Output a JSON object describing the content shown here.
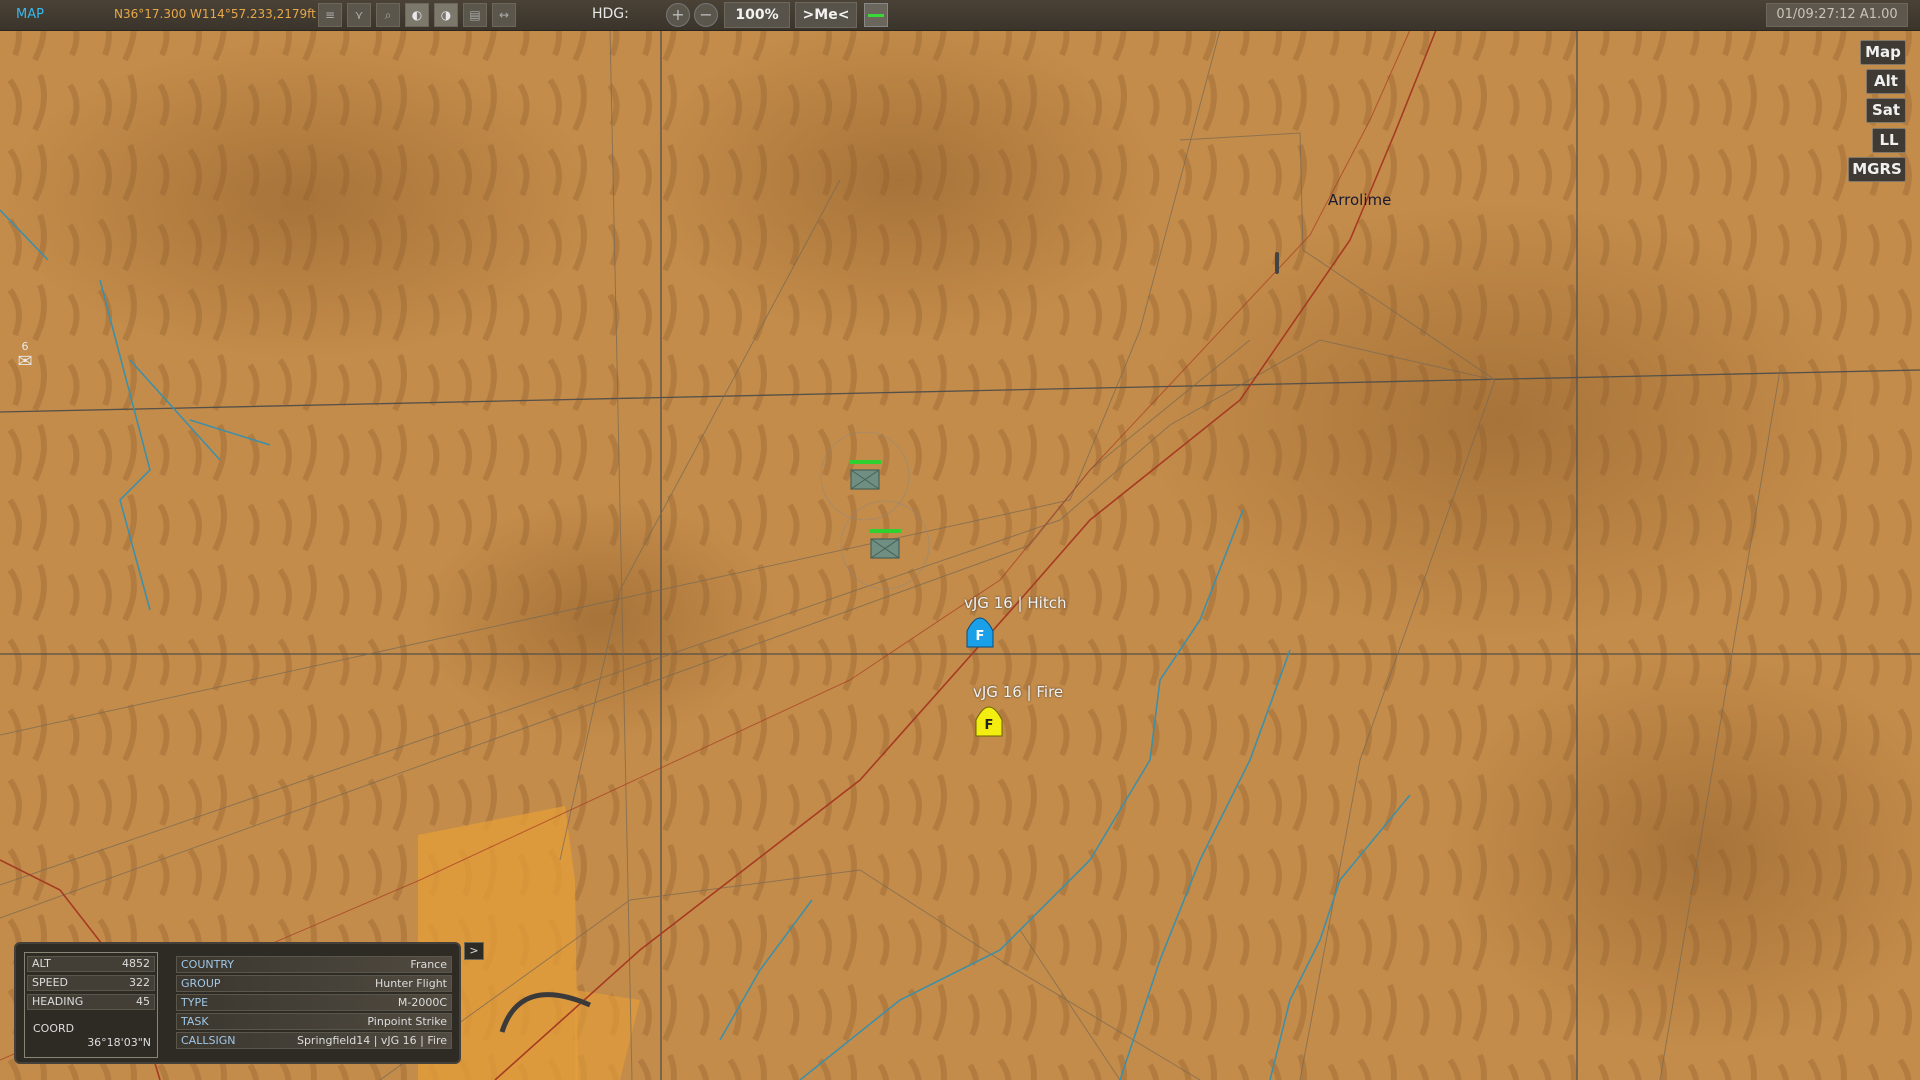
{
  "topbar": {
    "title": "MAP",
    "cursor_coords": "N36°17.300 W114°57.233,2179ft",
    "hdg_label": "HDG:",
    "zoom": "100%",
    "center_me": ">Me<",
    "time": "01/09:27:12 A1.00"
  },
  "map_buttons": [
    "Map",
    "Alt",
    "Sat",
    "LL",
    "MGRS"
  ],
  "places": {
    "arrolime": "Arrolime"
  },
  "units": {
    "hitch": {
      "label": "vJG 16 | Hitch",
      "symbol": "F",
      "color": "#1aa0e8"
    },
    "fire": {
      "label": "vJG 16 | Fire",
      "symbol": "F",
      "color": "#f4ee10"
    }
  },
  "messages": {
    "count": "6"
  },
  "info": {
    "alt_label": "ALT",
    "alt_value": "4852",
    "speed_label": "SPEED",
    "speed_value": "322",
    "heading_label": "HEADING",
    "heading_value": "45",
    "coord_label": "COORD",
    "coord_value": "36°18'03\"N",
    "country_label": "COUNTRY",
    "country_value": "France",
    "group_label": "GROUP",
    "group_value": "Hunter Flight",
    "type_label": "TYPE",
    "type_value": "M-2000C",
    "task_label": "TASK",
    "task_value": "Pinpoint Strike",
    "callsign_label": "CALLSIGN",
    "callsign_value": "Springfield14 | vJG 16 | Fire",
    "expand": ">"
  },
  "colors": {
    "terrain": "#c48c4a",
    "river": "#3f8fa8",
    "road": "#a63a22",
    "grid": "#555049"
  }
}
